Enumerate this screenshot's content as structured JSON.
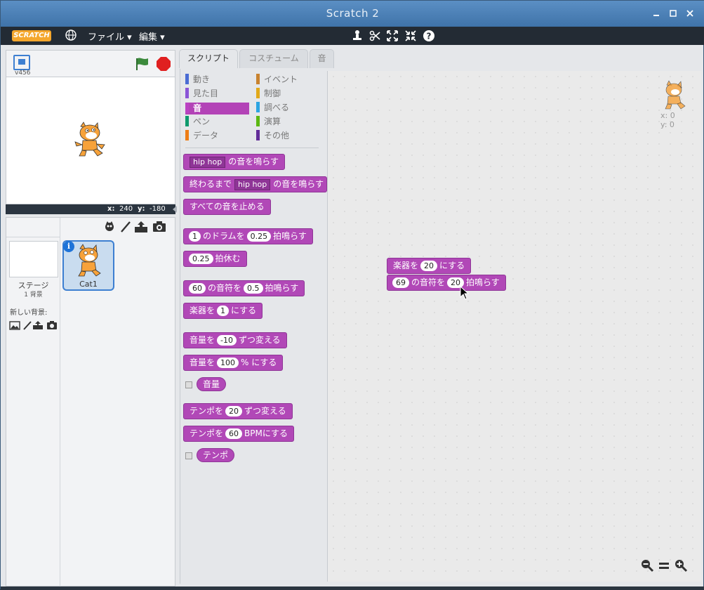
{
  "window": {
    "title": "Scratch 2"
  },
  "window_controls": [
    "minimize-icon",
    "maximize-icon",
    "close-icon"
  ],
  "menubar": {
    "logo": "SCRATCH",
    "file": "ファイル ▾",
    "edit": "編集 ▾",
    "tools": [
      "duplicate-icon",
      "delete-icon",
      "grow-icon",
      "shrink-icon",
      "help-icon"
    ]
  },
  "stage": {
    "version": "v456",
    "x_label": "x:",
    "x_value": "240",
    "y_label": "y:",
    "y_value": "-180"
  },
  "sprites": {
    "stage_name": "ステージ",
    "stage_backdrops": "1 背景",
    "new_backdrop_label": "新しい背景:",
    "sprite_name": "Cat1"
  },
  "tabs": {
    "scripts": "スクリプト",
    "costumes": "コスチューム",
    "sounds": "音"
  },
  "categories": {
    "motion": "動き",
    "looks": "見た目",
    "sound": "音",
    "pen": "ペン",
    "data": "データ",
    "events": "イベント",
    "control": "制御",
    "sensing": "調べる",
    "operators": "演算",
    "more": "その他"
  },
  "colors": {
    "motion": "#4a6cd4",
    "looks": "#8a55d7",
    "sound": "#bb42c3",
    "pen": "#0e9a6c",
    "data": "#ee7d16",
    "events": "#c88330",
    "control": "#e1a91a",
    "sensing": "#2ca5e2",
    "operators": "#5cb712",
    "more": "#632d99"
  },
  "blocks": {
    "play_sound": {
      "dd": "hip hop",
      "text": "の音を鳴らす"
    },
    "play_until_done": {
      "pre": "終わるまで",
      "dd": "hip hop",
      "text": "の音を鳴らす"
    },
    "stop_all": "すべての音を止める",
    "play_drum": {
      "dd": "1",
      "text1": "のドラムを",
      "val": "0.25",
      "text2": "拍鳴らす"
    },
    "rest": {
      "val": "0.25",
      "text": "拍休む"
    },
    "play_note": {
      "dd": "60",
      "text1": "の音符を",
      "val": "0.5",
      "text2": "拍鳴らす"
    },
    "set_instrument": {
      "pre": "楽器を",
      "dd": "1",
      "text": "にする"
    },
    "change_volume": {
      "pre": "音量を",
      "val": "-10",
      "text": "ずつ変える"
    },
    "set_volume": {
      "pre": "音量を",
      "val": "100",
      "text": "% にする"
    },
    "volume": "音量",
    "change_tempo": {
      "pre": "テンポを",
      "val": "20",
      "text": "ずつ変える"
    },
    "set_tempo": {
      "pre": "テンポを",
      "val": "60",
      "text": "BPMにする"
    },
    "tempo": "テンポ"
  },
  "script": {
    "block1": {
      "pre": "楽器を",
      "dd": "20",
      "text": "にする"
    },
    "block2": {
      "dd": "69",
      "text1": "の音符を",
      "val": "20",
      "text2": "拍鳴らす"
    },
    "x_label": "x: 0",
    "y_label": "y: 0"
  },
  "zoom": [
    "zoom-out-icon",
    "zoom-reset-icon",
    "zoom-in-icon"
  ]
}
